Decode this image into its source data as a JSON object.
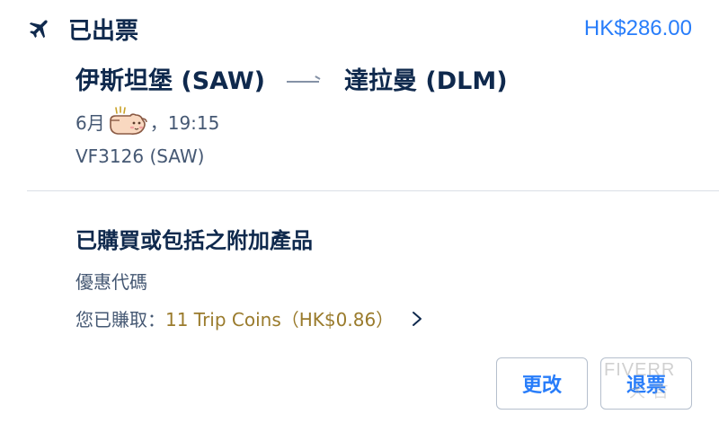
{
  "header": {
    "status": "已出票",
    "price": "HK$286.00",
    "icon": "airplane-icon"
  },
  "flight": {
    "origin": "伊斯坦堡 (SAW)",
    "destination": "達拉曼 (DLM)",
    "date_prefix": "6月",
    "date_suffix": "，19:15",
    "flight_number": "VF3126 (SAW)"
  },
  "addons": {
    "title": "已購買或包括之附加產品",
    "promo_label": "優惠代碼",
    "earned_label": "您已賺取：",
    "earned_value": "11 Trip Coins（HK$0.86）"
  },
  "buttons": {
    "change": "更改",
    "refund": "退票"
  },
  "watermark": "FIVERR",
  "colors": {
    "accent": "#287dfa",
    "title": "#0f294d",
    "secondary": "#455873",
    "coins": "#9a7b2c"
  }
}
